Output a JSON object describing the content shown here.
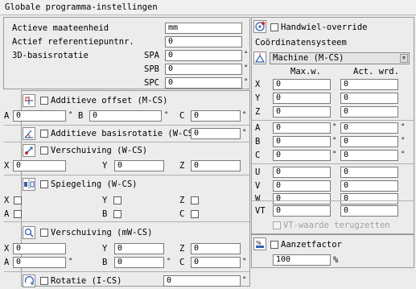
{
  "window": {
    "title": "Globale programma-instellingen"
  },
  "general": {
    "active_unit_label": "Actieve maateenheid",
    "active_unit_value": "mm",
    "active_ref_label": "Actief referentiepuntnr.",
    "active_ref_value": "0",
    "rotation3d_label": "3D-basisrotatie",
    "spa_label": "SPA",
    "spa_value": "0",
    "spb_label": "SPB",
    "spb_value": "0",
    "spc_label": "SPC",
    "spc_value": "0"
  },
  "additive_offset": {
    "label": "Additieve offset (M-CS)",
    "a_label": "A",
    "a_value": "0",
    "b_label": "B",
    "b_value": "0",
    "c_label": "C",
    "c_value": "0"
  },
  "additive_basic_rotation": {
    "label": "Additieve basisrotatie (W-CS)",
    "value": "0"
  },
  "shift": {
    "label": "Verschuiving (W-CS)",
    "x_label": "X",
    "x_value": "0",
    "y_label": "Y",
    "y_value": "0",
    "z_label": "Z",
    "z_value": "0"
  },
  "mirror": {
    "label": "Spiegeling (W-CS)",
    "x_label": "X",
    "y_label": "Y",
    "z_label": "Z",
    "a_label": "A",
    "b_label": "B",
    "c_label": "C"
  },
  "shift_mw": {
    "label": "Verschuiving (mW-CS)",
    "x_label": "X",
    "x_value": "0",
    "y_label": "Y",
    "y_value": "0",
    "z_label": "Z",
    "z_value": "0",
    "a_label": "A",
    "a_value": "0",
    "b_label": "B",
    "b_value": "0",
    "c_label": "C",
    "c_value": "0"
  },
  "rotation_ics": {
    "label": "Rotatie (I-CS)",
    "value": "0"
  },
  "handwheel": {
    "override_label": "Handwiel-override",
    "coord_system_label": "Coördinatensysteem",
    "coord_system_value": "Machine (M-CS)",
    "col_max": "Max.w.",
    "col_act": "Act. wrd.",
    "rows": [
      {
        "axis": "X",
        "max": "0",
        "act": "0",
        "deg": false
      },
      {
        "axis": "Y",
        "max": "0",
        "act": "0",
        "deg": false
      },
      {
        "axis": "Z",
        "max": "0",
        "act": "0",
        "deg": false
      },
      {
        "axis": "A",
        "max": "0",
        "act": "0",
        "deg": true
      },
      {
        "axis": "B",
        "max": "0",
        "act": "0",
        "deg": true
      },
      {
        "axis": "C",
        "max": "0",
        "act": "0",
        "deg": true
      },
      {
        "axis": "U",
        "max": "0",
        "act": "0",
        "deg": false
      },
      {
        "axis": "V",
        "max": "0",
        "act": "0",
        "deg": false
      },
      {
        "axis": "W",
        "max": "0",
        "act": "0",
        "deg": false
      }
    ],
    "vt_label": "VT",
    "vt_max": "0",
    "vt_act": "0",
    "vt_reset_label": "VT-waarde terugzetten"
  },
  "feed_factor": {
    "label": "Aanzetfactor",
    "value": "100",
    "unit": "%"
  },
  "symbols": {
    "degree": "°"
  }
}
